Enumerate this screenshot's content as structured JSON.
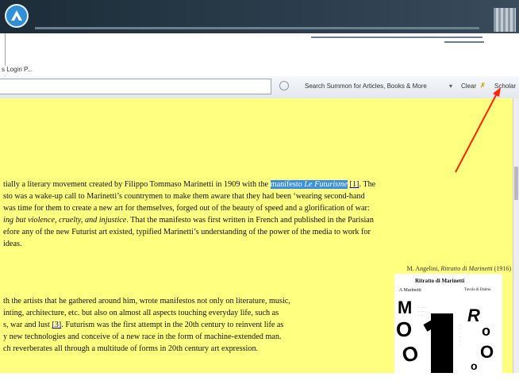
{
  "browser": {
    "tab_label": "s Login P...",
    "search_label": "Search Summon for Articles, Books & More",
    "dropdown_caret": "▾",
    "clear_label": "Clear",
    "clear_icon": "✗",
    "scholar_label": "Scholar"
  },
  "article": {
    "p1": {
      "l1_a": "tially a literary movement created by Filippo Tommaso Marinetti in 1909 with the ",
      "l1_hl_a": "manifesto ",
      "l1_hl_b": "Le Futurisme",
      "l1_ref": "[1]",
      "l1_tail": ". The",
      "l2": "sto was a wake-up call to Marinetti’s countrymen to make them aware that they had been ‘wearing second-hand",
      "l3": " was time for them to create a new art for themselves, forged out of the beauty of speed and a glorification of war:",
      "l4_it": "ing but violence, cruelty, and injustice",
      "l4_rest": ". That the manifesto was first written in French and published in the Parisian",
      "l5": "efore any of the new Futurist art existed, typified Marinetti’s understanding of the power of the media to work for",
      "l6": " ideas."
    },
    "caption_a": "M. Angelini, ",
    "caption_it": "Ritratto di Marinetti",
    "caption_b": " (1916)",
    "p2": {
      "l1": "th the artists that he gathered around him, wrote manifestos not only on literature, music,",
      "l2": "inting, architecture, etc. but also on almost all aspects touching everyday life, such as",
      "l3_a": "s, war and lust ",
      "l3_ref": "[3]",
      "l3_b": ". Futurism was the first attempt in the 20th century to reinvent life as",
      "l4": "y new technologies and conceive of a new race in the form of machine-extended man.",
      "l5": "ch reverberates all through a multitude of forms in 20th century art expression."
    }
  },
  "poster": {
    "title": "Ritratto di Marinetti",
    "subtitle": "Tavola di Dalmo",
    "left_name": "A Marinetti"
  },
  "colors": {
    "page_highlight": "#ffff80",
    "selection": "#3b8fe0",
    "annotation_arrow": "#ff2200",
    "header": "#1c2c38"
  }
}
